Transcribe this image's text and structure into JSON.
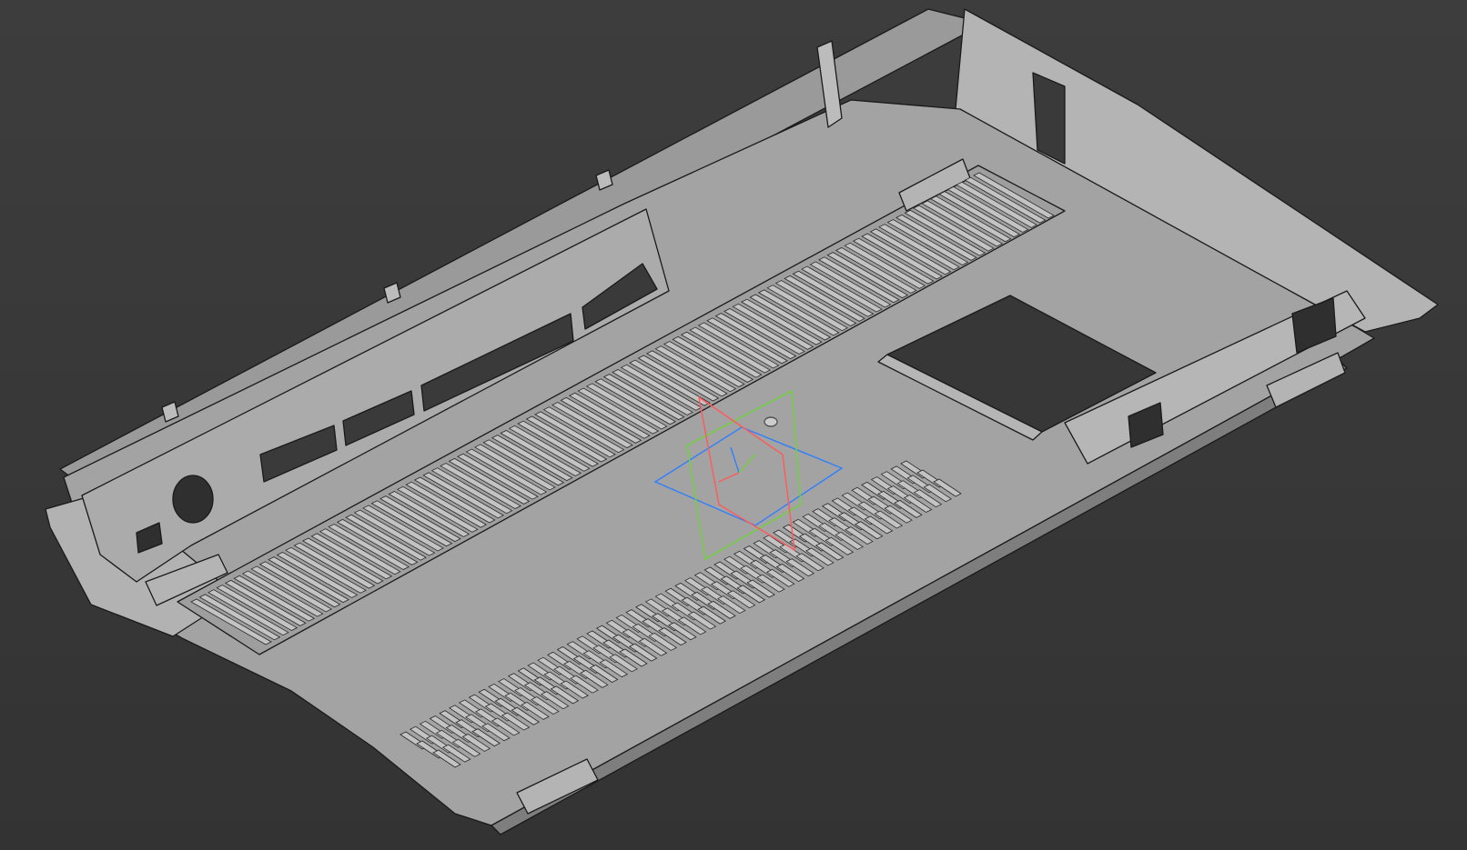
{
  "viewport": {
    "background_top": "#3d3d3d",
    "background_bottom": "#333333"
  },
  "model": {
    "face_color": "#a5a5a5",
    "side_color": "#8f8f8f",
    "edge_color": "#1a1a1a",
    "slot_face_color": "#b8b8b8"
  },
  "origin_planes": {
    "xy_plane_color": "#2f7fff",
    "xz_plane_color": "#6fd43a",
    "yz_plane_color": "#ff5a5a"
  }
}
